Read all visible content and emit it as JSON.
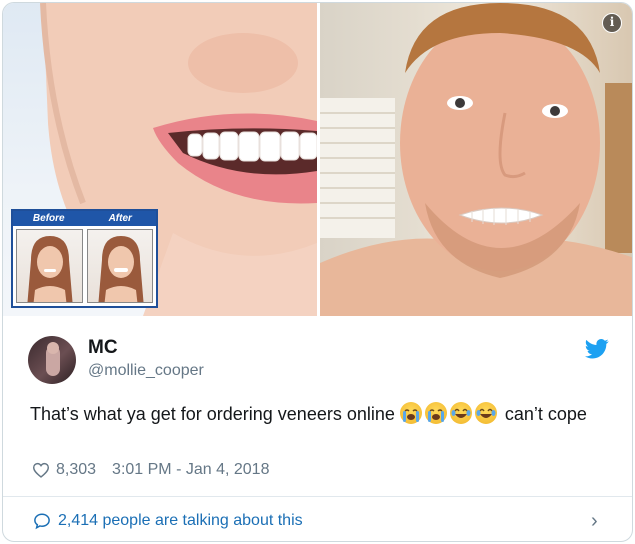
{
  "media": {
    "before_label": "Before",
    "after_label": "After",
    "info_icon": "info-icon"
  },
  "tweet": {
    "display_name": "MC",
    "handle": "@mollie_cooper",
    "text_before_emoji": "That’s what ya get for ordering veneers online ",
    "emojis": [
      "loudly-crying-face",
      "loudly-crying-face",
      "face-with-tears-of-joy",
      "face-with-tears-of-joy"
    ],
    "text_after_emoji": " can’t cope",
    "likes": "8,303",
    "timestamp": "3:01 PM - Jan 4, 2018",
    "talking_text": "2,414 people are talking about this"
  },
  "colors": {
    "twitter_blue": "#1da1f2",
    "link_blue": "#1b6fb5",
    "muted_gray": "#657786",
    "inset_blue": "#1f56a8"
  }
}
